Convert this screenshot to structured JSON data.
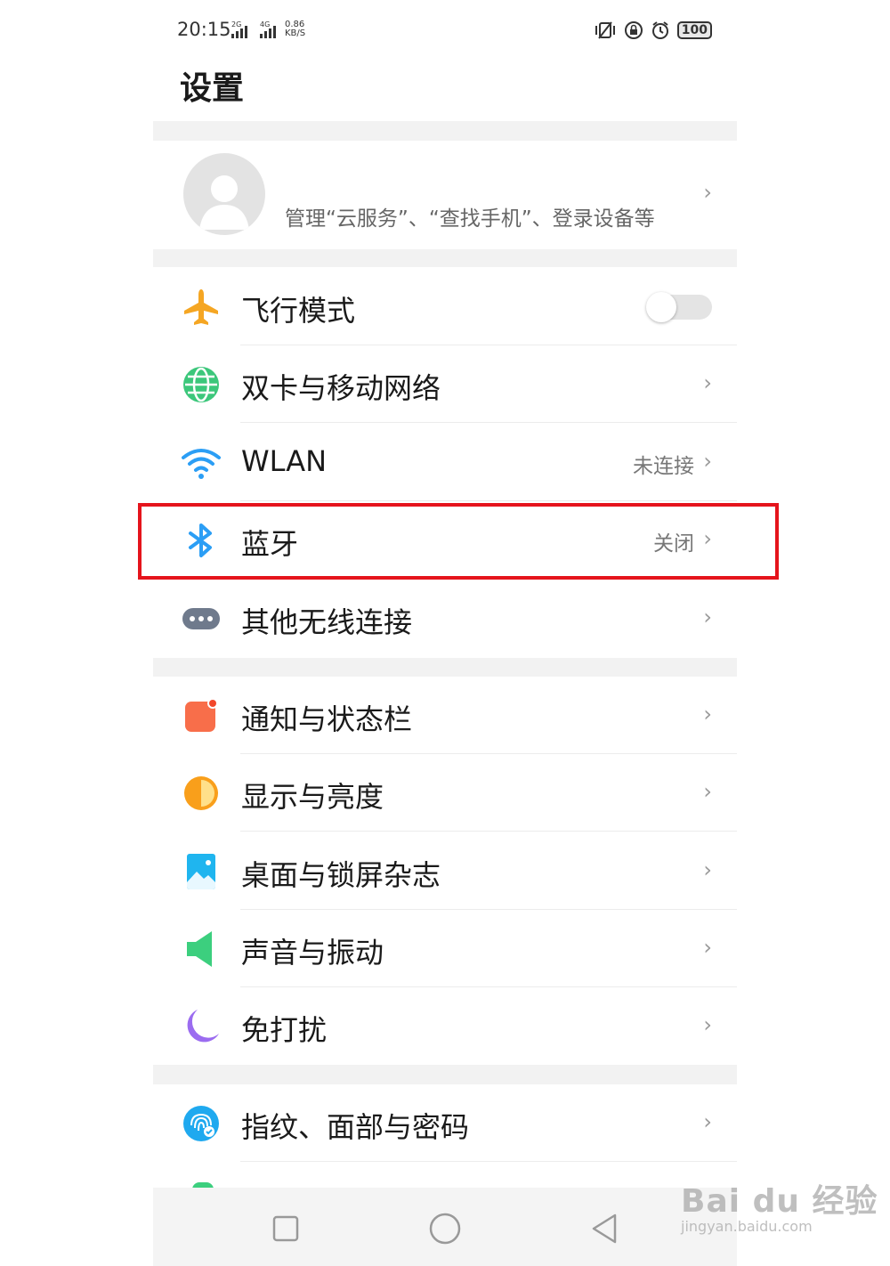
{
  "status_bar": {
    "time": "20:15",
    "sim1_network": "2G",
    "sim2_network": "4G",
    "speed_value": "0.86",
    "speed_unit": "KB/S",
    "battery": "100"
  },
  "header": {
    "title": "设置"
  },
  "account": {
    "subtitle": "管理“云服务”、“查找手机”、登录设备等"
  },
  "sections": [
    {
      "items": [
        {
          "label": "飞行模式",
          "icon": "airplane-icon",
          "toggle_on": false
        },
        {
          "label": "双卡与移动网络",
          "icon": "globe-icon"
        },
        {
          "label": "WLAN",
          "icon": "wifi-icon",
          "value": "未连接"
        },
        {
          "label": "蓝牙",
          "icon": "bluetooth-icon",
          "value": "关闭"
        },
        {
          "label": "其他无线连接",
          "icon": "more-connections-icon"
        }
      ]
    },
    {
      "items": [
        {
          "label": "通知与状态栏",
          "icon": "notification-icon"
        },
        {
          "label": "显示与亮度",
          "icon": "brightness-icon"
        },
        {
          "label": "桌面与锁屏杂志",
          "icon": "wallpaper-icon"
        },
        {
          "label": "声音与振动",
          "icon": "speaker-icon"
        },
        {
          "label": "免打扰",
          "icon": "moon-icon"
        }
      ]
    },
    {
      "items": [
        {
          "label": "指纹、面部与密码",
          "icon": "fingerprint-icon"
        }
      ]
    }
  ],
  "chevron": "›",
  "highlight_color": "#e5141c",
  "watermark": {
    "logo": "Bai du 经验",
    "url": "jingyan.baidu.com"
  }
}
